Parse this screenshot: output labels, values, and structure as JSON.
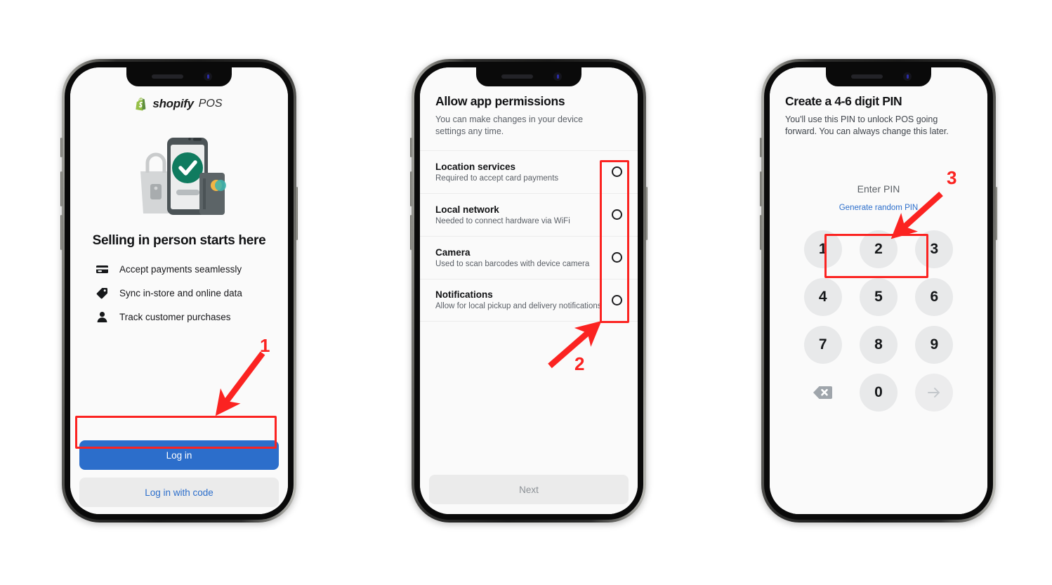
{
  "screens": [
    {
      "id": "login",
      "brand": {
        "name": "shopify",
        "product": "POS",
        "logo_icon": "shopify-bag-icon"
      },
      "illustration": "pos-checkout-illustration",
      "headline": "Selling in person starts here",
      "features": [
        {
          "icon": "credit-card-icon",
          "label": "Accept payments seamlessly"
        },
        {
          "icon": "tag-icon",
          "label": "Sync in-store and online data"
        },
        {
          "icon": "person-icon",
          "label": "Track customer purchases"
        }
      ],
      "primary_button": "Log in",
      "secondary_button": "Log in with code"
    },
    {
      "id": "permissions",
      "title": "Allow app permissions",
      "subtitle": "You can make changes in your device settings any time.",
      "permissions": [
        {
          "name": "Location services",
          "desc": "Required to accept card payments",
          "state": "off"
        },
        {
          "name": "Local network",
          "desc": "Needed to connect hardware via WiFi",
          "state": "off"
        },
        {
          "name": "Camera",
          "desc": "Used to scan barcodes with device camera",
          "state": "off"
        },
        {
          "name": "Notifications",
          "desc": "Allow for local pickup and delivery notifications",
          "state": "off"
        }
      ],
      "next_button": "Next"
    },
    {
      "id": "create-pin",
      "title": "Create a 4-6 digit PIN",
      "subtitle": "You'll use this PIN to unlock POS going forward. You can always change this later.",
      "pin_placeholder": "Enter PIN",
      "generate_link": "Generate random PIN",
      "keypad": [
        "1",
        "2",
        "3",
        "4",
        "5",
        "6",
        "7",
        "8",
        "9",
        "backspace",
        "0",
        "submit"
      ],
      "backspace_icon": "backspace-icon",
      "submit_icon": "arrow-right-icon"
    }
  ],
  "annotations": [
    {
      "number": "1",
      "target": "Log in",
      "color": "#fb2321"
    },
    {
      "number": "2",
      "target": "permission toggles",
      "color": "#fb2321"
    },
    {
      "number": "3",
      "target": "Enter PIN",
      "color": "#fb2321"
    }
  ],
  "colors": {
    "accent_blue": "#2c6ecb",
    "annotation_red": "#fb2321",
    "screen_bg": "#fafafa",
    "key_bg": "#e8e9ea",
    "shopify_green": "#5a8a3c"
  }
}
